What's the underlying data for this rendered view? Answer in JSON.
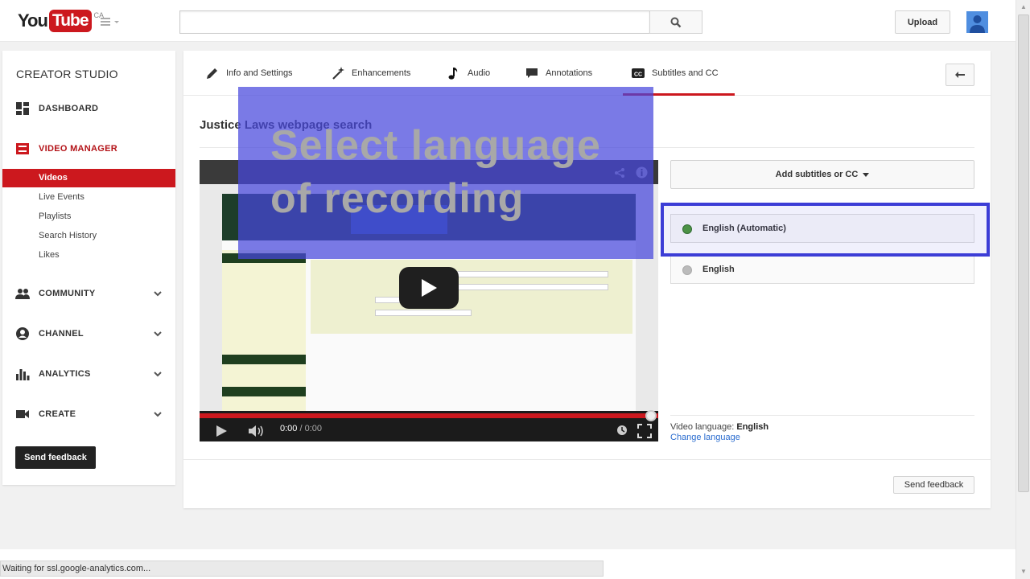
{
  "header": {
    "logo_you": "You",
    "logo_tube": "Tube",
    "logo_region": "CA",
    "search_placeholder": "",
    "upload_label": "Upload"
  },
  "sidebar": {
    "title": "CREATOR STUDIO",
    "dashboard": "DASHBOARD",
    "video_manager": "VIDEO MANAGER",
    "video_manager_items": [
      "Videos",
      "Live Events",
      "Playlists",
      "Search History",
      "Likes"
    ],
    "selected_item": "Videos",
    "community": "COMMUNITY",
    "channel": "CHANNEL",
    "analytics": "ANALYTICS",
    "create": "CREATE",
    "feedback_label": "Send feedback"
  },
  "tabs": [
    {
      "label": "Info and Settings",
      "icon": "pencil-icon"
    },
    {
      "label": "Enhancements",
      "icon": "magic-wand-icon"
    },
    {
      "label": "Audio",
      "icon": "music-note-icon"
    },
    {
      "label": "Annotations",
      "icon": "speech-bubble-icon"
    },
    {
      "label": "Subtitles and CC",
      "icon": "cc-icon"
    }
  ],
  "active_tab": "Subtitles and CC",
  "main": {
    "video_title": "Justice Laws webpage search",
    "player_time_current": "0:00",
    "player_time_total": "0:00",
    "player_progress": 0,
    "add_subtitles_label": "Add subtitles or CC",
    "languages": [
      {
        "label": "English (Automatic)",
        "status_color": "#4e9a3a",
        "highlighted": true
      },
      {
        "label": "English",
        "status_color": "#bbbbbb",
        "highlighted": false
      }
    ],
    "video_language_label": "Video language: ",
    "video_language_value": "English",
    "change_language_label": "Change language",
    "feedback_label": "Send feedback"
  },
  "overlay": {
    "line1": "Select language",
    "line2": "of recording"
  },
  "status_bar": {
    "text": "Waiting for ssl.google-analytics.com..."
  },
  "colors": {
    "brand_red": "#cc181e",
    "highlight_blue": "#3c3dd6",
    "link_blue": "#2a6ccf"
  }
}
